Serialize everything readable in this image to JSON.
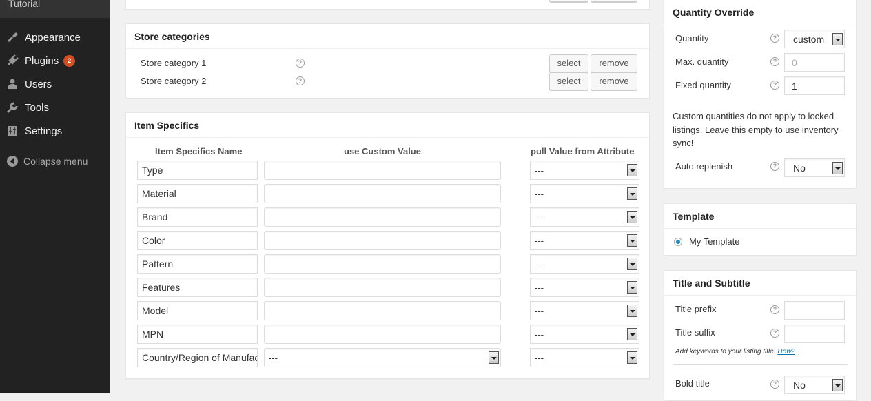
{
  "sidebar": {
    "site_label": "Tutorial",
    "items": [
      {
        "label": "Appearance",
        "icon": "paintbrush-icon"
      },
      {
        "label": "Plugins",
        "icon": "plugin-icon",
        "badge": "2"
      },
      {
        "label": "Users",
        "icon": "user-icon"
      },
      {
        "label": "Tools",
        "icon": "wrench-icon"
      },
      {
        "label": "Settings",
        "icon": "settings-sliders-icon"
      }
    ],
    "collapse_label": "Collapse menu"
  },
  "store_categories": {
    "title": "Store categories",
    "rows": [
      {
        "label": "Store category 1",
        "select_label": "select",
        "remove_label": "remove"
      },
      {
        "label": "Store category 2",
        "select_label": "select",
        "remove_label": "remove"
      }
    ]
  },
  "item_specifics": {
    "title": "Item Specifics",
    "columns": [
      "Item Specifics Name",
      "use Custom Value",
      "pull Value from Attribute"
    ],
    "rows": [
      {
        "name": "Type",
        "custom": "",
        "custom_is_select": false,
        "attribute": "---"
      },
      {
        "name": "Material",
        "custom": "",
        "custom_is_select": false,
        "attribute": "---"
      },
      {
        "name": "Brand",
        "custom": "",
        "custom_is_select": false,
        "attribute": "---"
      },
      {
        "name": "Color",
        "custom": "",
        "custom_is_select": false,
        "attribute": "---"
      },
      {
        "name": "Pattern",
        "custom": "",
        "custom_is_select": false,
        "attribute": "---"
      },
      {
        "name": "Features",
        "custom": "",
        "custom_is_select": false,
        "attribute": "---"
      },
      {
        "name": "Model",
        "custom": "",
        "custom_is_select": false,
        "attribute": "---"
      },
      {
        "name": "MPN",
        "custom": "",
        "custom_is_select": false,
        "attribute": "---"
      },
      {
        "name": "Country/Region of Manufacture",
        "custom": "---",
        "custom_is_select": true,
        "attribute": "---"
      }
    ]
  },
  "quantity_override": {
    "title": "Quantity Override",
    "quantity_label": "Quantity",
    "quantity_value": "custom",
    "max_quantity_label": "Max. quantity",
    "max_quantity_value": "0",
    "fixed_quantity_label": "Fixed quantity",
    "fixed_quantity_value": "1",
    "note": "Custom quantities do not apply to locked listings. Leave this empty to use inventory sync!",
    "auto_replenish_label": "Auto replenish",
    "auto_replenish_value": "No"
  },
  "template": {
    "title": "Template",
    "option_label": "My Template",
    "selected": true
  },
  "title_subtitle": {
    "title": "Title and Subtitle",
    "prefix_label": "Title prefix",
    "prefix_value": "",
    "suffix_label": "Title suffix",
    "suffix_value": "",
    "hint": "Add keywords to your listing title.",
    "hint_link": "How?",
    "bold_label": "Bold title",
    "bold_value": "No"
  },
  "colors": {
    "sidebar_bg": "#222222",
    "badge": "#d54e21",
    "link": "#0073aa",
    "radio": "#1e8cbe"
  }
}
